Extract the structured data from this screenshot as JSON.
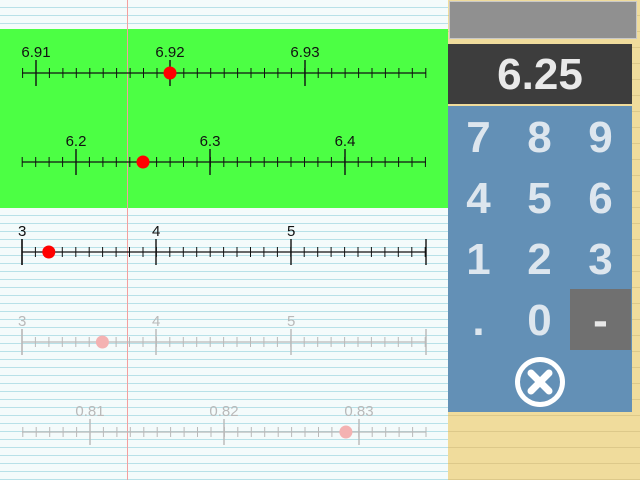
{
  "display": {
    "value": "6.25"
  },
  "keypad": {
    "keys": [
      "7",
      "8",
      "9",
      "4",
      "5",
      "6",
      "1",
      "2",
      "3",
      ".",
      "0",
      "-"
    ],
    "clear_icon": "close-circle-icon"
  },
  "number_lines": [
    {
      "name": "zoom-6.9",
      "labels": [
        "6.91",
        "6.92",
        "6.93"
      ],
      "marker_value": 6.92,
      "faded": false
    },
    {
      "name": "zoom-6",
      "labels": [
        "6.2",
        "6.3",
        "6.4"
      ],
      "marker_value": 6.25,
      "faded": false
    },
    {
      "name": "ones",
      "labels": [
        "3",
        "4",
        "5"
      ],
      "marker_value": 3.2,
      "faded": false
    },
    {
      "name": "ones-faded",
      "labels": [
        "3",
        "4",
        "5"
      ],
      "marker_value": 3.6,
      "faded": true
    },
    {
      "name": "hundredths-faded",
      "labels": [
        "0.81",
        "0.82",
        "0.83"
      ],
      "marker_value": 0.8291,
      "faded": true
    }
  ],
  "colors": {
    "highlight": "#4cff44",
    "marker": "#ff0000",
    "keypad": "#6390b6",
    "display": "#3d3d3d"
  }
}
